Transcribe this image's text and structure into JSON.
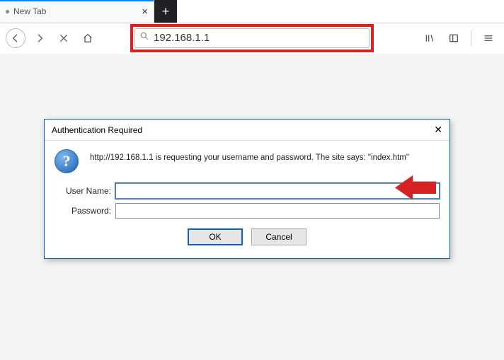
{
  "tab": {
    "title": "New Tab"
  },
  "urlbar": {
    "value": "192.168.1.1"
  },
  "dialog": {
    "title": "Authentication Required",
    "message": "http://192.168.1.1 is requesting your username and password. The site says: \"index.htm\"",
    "username_label": "User Name:",
    "password_label": "Password:",
    "username_value": "",
    "password_value": "",
    "ok_label": "OK",
    "cancel_label": "Cancel"
  }
}
